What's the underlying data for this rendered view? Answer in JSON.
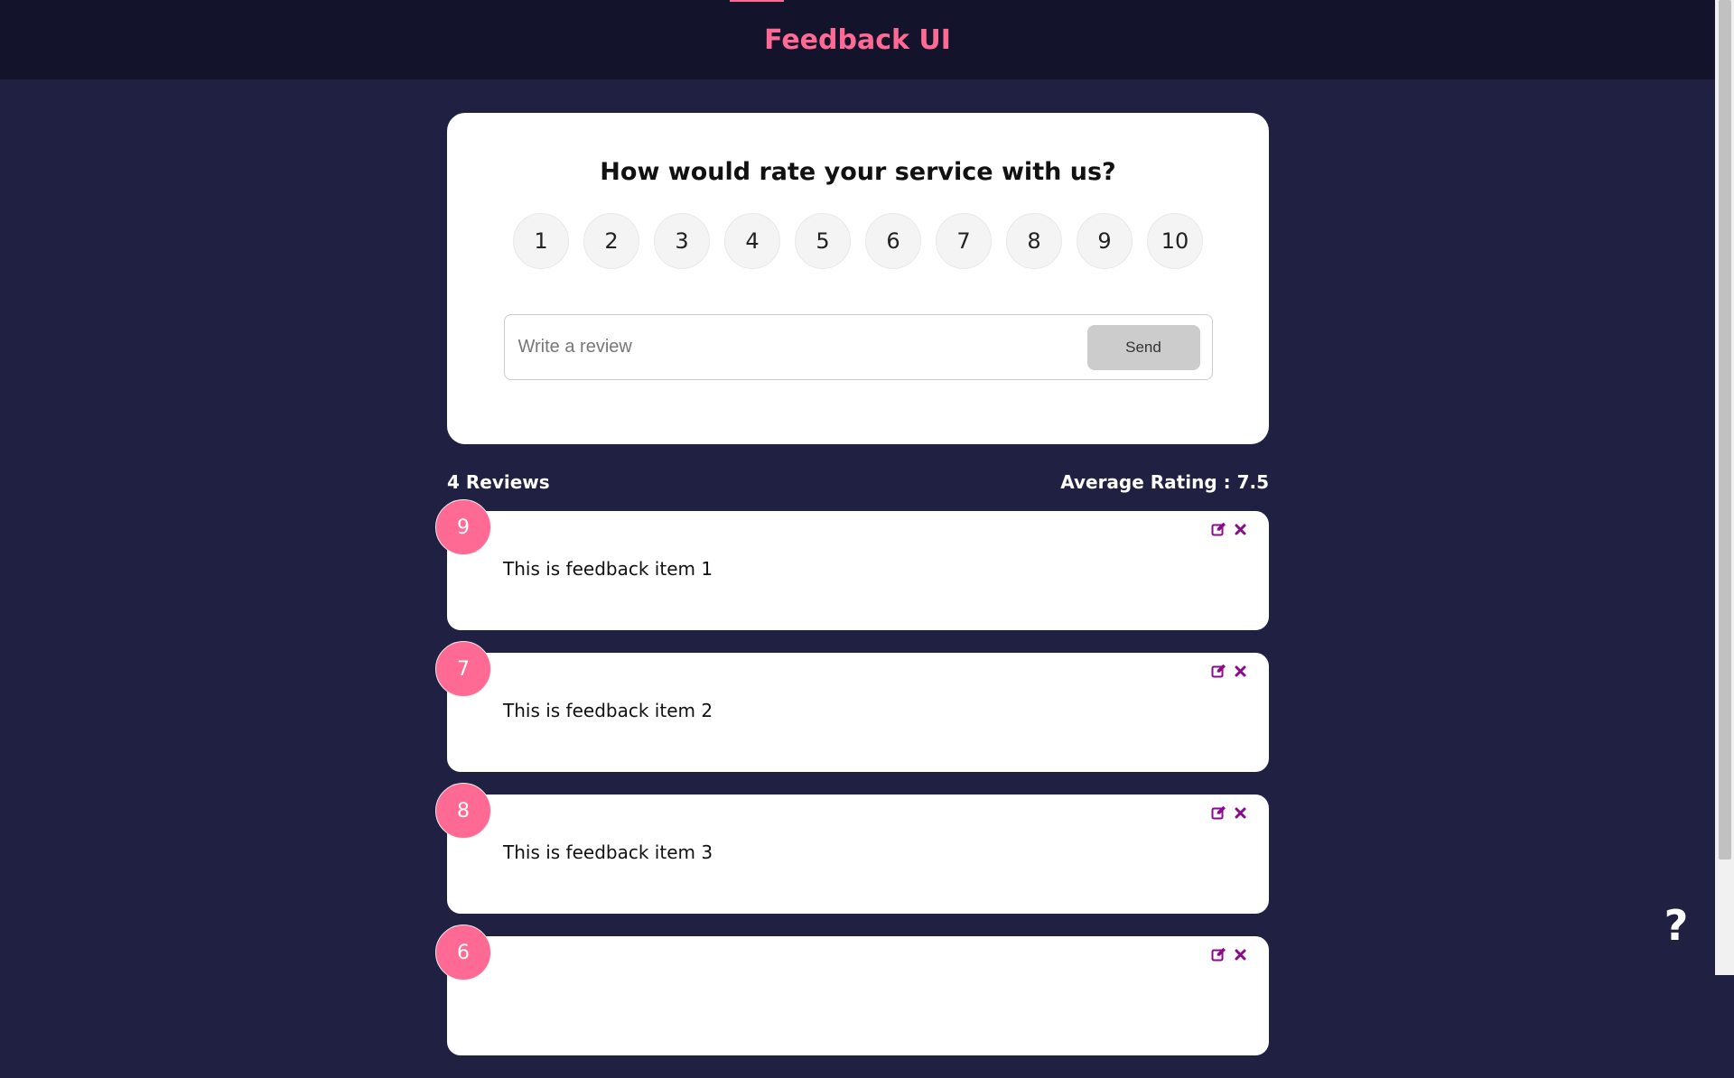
{
  "header": {
    "title": "Feedback UI"
  },
  "rating_card": {
    "question": "How would rate your service with us?",
    "options": [
      "1",
      "2",
      "3",
      "4",
      "5",
      "6",
      "7",
      "8",
      "9",
      "10"
    ],
    "review_placeholder": "Write a review",
    "send_label": "Send"
  },
  "stats": {
    "reviews_count": "4 Reviews",
    "average_rating": "Average Rating : 7.5"
  },
  "feedback": [
    {
      "rating": "9",
      "text": "This is feedback item 1"
    },
    {
      "rating": "7",
      "text": "This is feedback item 2"
    },
    {
      "rating": "8",
      "text": "This is feedback item 3"
    },
    {
      "rating": "6",
      "text": ""
    }
  ],
  "icons": {
    "edit": "edit-icon",
    "delete": "close-icon",
    "help": "question-icon"
  },
  "help": {
    "label": "?"
  },
  "colors": {
    "accent": "#ff6a95",
    "background": "#202142",
    "header_bg": "#13142b",
    "icon": "#8b0a8b"
  }
}
